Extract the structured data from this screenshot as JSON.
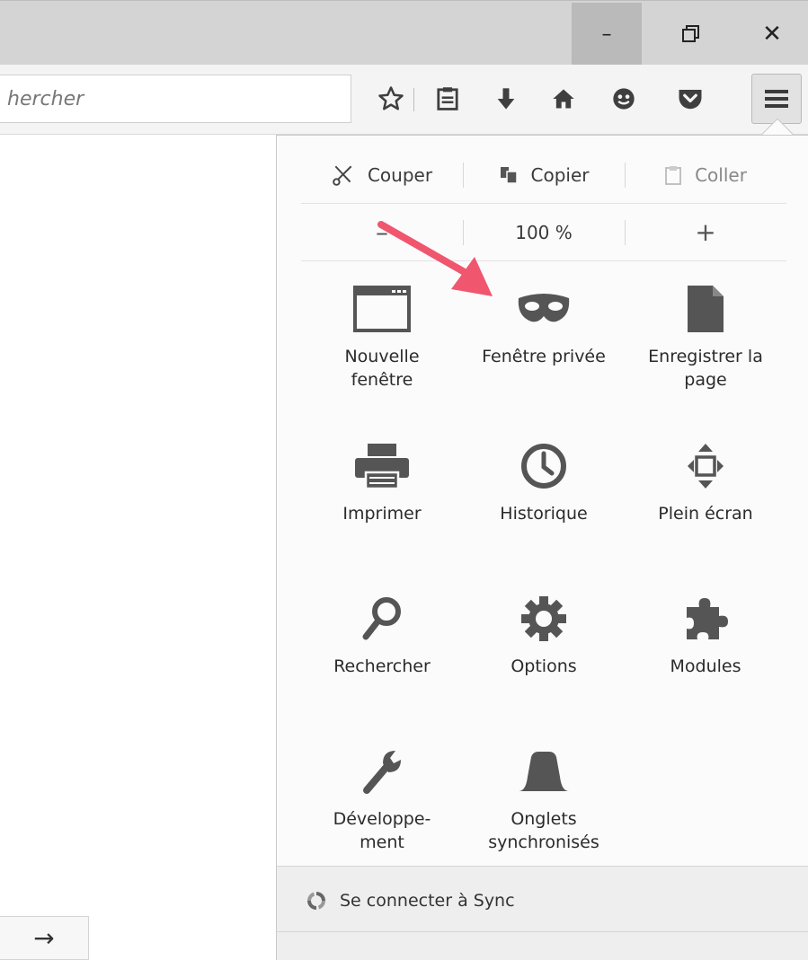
{
  "window": {
    "minimize_glyph": "–",
    "restore_glyph": "❐",
    "close_glyph": "✕"
  },
  "navbar": {
    "search_value": "hercher",
    "toolbar_icons": [
      "star-icon",
      "reading-list-icon",
      "download-icon",
      "home-icon",
      "smiley-icon",
      "pocket-icon"
    ]
  },
  "menu": {
    "edit": {
      "cut_label": "Couper",
      "copy_label": "Copier",
      "paste_label": "Coller"
    },
    "zoom": {
      "minus": "–",
      "level": "100 %",
      "plus": "+"
    },
    "items": [
      {
        "label": "Nouvelle\nfenêtre",
        "icon": "new-window-icon"
      },
      {
        "label": "Fenêtre privée",
        "icon": "private-mask-icon"
      },
      {
        "label": "Enregistrer la\npage",
        "icon": "save-page-icon"
      },
      {
        "label": "Imprimer",
        "icon": "printer-icon"
      },
      {
        "label": "Historique",
        "icon": "history-clock-icon"
      },
      {
        "label": "Plein écran",
        "icon": "fullscreen-icon"
      },
      {
        "label": "Rechercher",
        "icon": "search-icon"
      },
      {
        "label": "Options",
        "icon": "gear-icon"
      },
      {
        "label": "Modules",
        "icon": "puzzle-icon"
      },
      {
        "label": "Développe-\nment",
        "icon": "wrench-icon"
      },
      {
        "label": "Onglets\nsynchronisés",
        "icon": "synced-tabs-icon"
      }
    ],
    "sync_label": "Se connecter à Sync"
  },
  "bottom": {
    "go_glyph": "→"
  },
  "colors": {
    "annotation_arrow": "#f0566e",
    "icon_gray": "#555555"
  }
}
